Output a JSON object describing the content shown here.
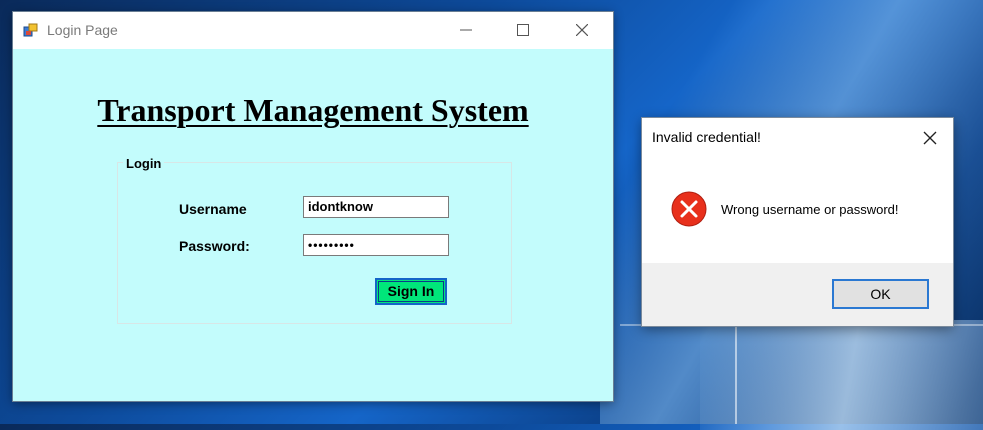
{
  "main_window": {
    "title": "Login Page",
    "heading": "Transport Management System",
    "group_label": "Login",
    "username_label": "Username",
    "password_label": "Password:",
    "username_value": "idontknow",
    "password_value": "•••••••••",
    "signin_label": "Sign In",
    "background_color": "#c3fcfc",
    "signin_color": "#00e67a"
  },
  "dialog": {
    "title": "Invalid credential!",
    "message": "Wrong username or password!",
    "ok_label": "OK",
    "icon": "error-icon",
    "icon_color": "#e8301c"
  }
}
